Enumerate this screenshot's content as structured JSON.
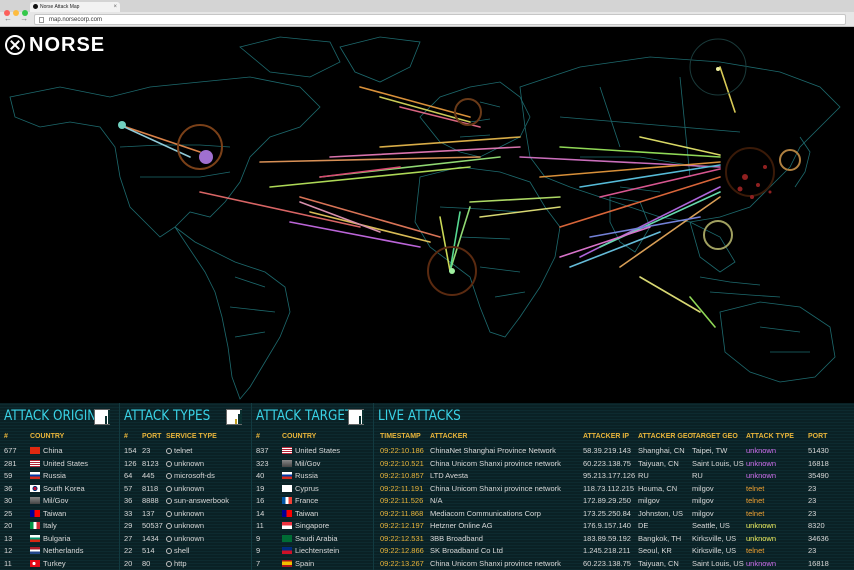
{
  "browser": {
    "tab_title": "Norse Attack Map",
    "tab_close": "×",
    "nav": "← → C",
    "url": "map.norsecorp.com"
  },
  "logo": {
    "text": "NORSE"
  },
  "colors": {
    "accent": "#3ad3e6",
    "header": "#e8b43a",
    "panel_bg": "#0b2227"
  },
  "attack_origins": {
    "title": "ATTACK ORIGINS",
    "headers": [
      "#",
      "COUNTRY"
    ],
    "rows": [
      {
        "count": "677",
        "country": "China",
        "flag": "cn"
      },
      {
        "count": "281",
        "country": "United States",
        "flag": "us"
      },
      {
        "count": "59",
        "country": "Russia",
        "flag": "ru"
      },
      {
        "count": "36",
        "country": "South Korea",
        "flag": "kr"
      },
      {
        "count": "30",
        "country": "Mil/Gov",
        "flag": "mil"
      },
      {
        "count": "25",
        "country": "Taiwan",
        "flag": "tw"
      },
      {
        "count": "20",
        "country": "Italy",
        "flag": "it"
      },
      {
        "count": "13",
        "country": "Bulgaria",
        "flag": "bg"
      },
      {
        "count": "12",
        "country": "Netherlands",
        "flag": "nl"
      },
      {
        "count": "11",
        "country": "Turkey",
        "flag": "tr"
      }
    ]
  },
  "attack_types": {
    "title": "ATTACK TYPES",
    "headers": [
      "#",
      "PORT",
      "SERVICE TYPE"
    ],
    "rows": [
      {
        "count": "154",
        "port": "23",
        "service": "telnet"
      },
      {
        "count": "126",
        "port": "8123",
        "service": "unknown"
      },
      {
        "count": "64",
        "port": "445",
        "service": "microsoft-ds"
      },
      {
        "count": "57",
        "port": "8118",
        "service": "unknown"
      },
      {
        "count": "36",
        "port": "8888",
        "service": "sun-answerbook"
      },
      {
        "count": "33",
        "port": "137",
        "service": "unknown"
      },
      {
        "count": "29",
        "port": "50537",
        "service": "unknown"
      },
      {
        "count": "27",
        "port": "1434",
        "service": "unknown"
      },
      {
        "count": "22",
        "port": "514",
        "service": "shell"
      },
      {
        "count": "20",
        "port": "80",
        "service": "http"
      }
    ]
  },
  "attack_targets": {
    "title": "ATTACK TARGETS",
    "headers": [
      "#",
      "COUNTRY"
    ],
    "rows": [
      {
        "count": "837",
        "country": "United States",
        "flag": "us"
      },
      {
        "count": "323",
        "country": "Mil/Gov",
        "flag": "mil"
      },
      {
        "count": "40",
        "country": "Russia",
        "flag": "ru"
      },
      {
        "count": "19",
        "country": "Cyprus",
        "flag": "cy"
      },
      {
        "count": "16",
        "country": "France",
        "flag": "fr"
      },
      {
        "count": "14",
        "country": "Taiwan",
        "flag": "tw"
      },
      {
        "count": "11",
        "country": "Singapore",
        "flag": "sg"
      },
      {
        "count": "9",
        "country": "Saudi Arabia",
        "flag": "sa"
      },
      {
        "count": "9",
        "country": "Liechtenstein",
        "flag": "li"
      },
      {
        "count": "7",
        "country": "Spain",
        "flag": "es"
      }
    ]
  },
  "live_attacks": {
    "title": "LIVE ATTACKS",
    "headers": [
      "TIMESTAMP",
      "ATTACKER",
      "ATTACKER IP",
      "ATTACKER GEO",
      "TARGET GEO",
      "ATTACK TYPE",
      "PORT"
    ],
    "rows": [
      {
        "time": "09:22:10.186",
        "attacker": "ChinaNet Shanghai Province Network",
        "ip": "58.39.219.143",
        "geo": "Shanghai, CN",
        "target": "Taipei, TW",
        "type": "unknown",
        "port": "51430"
      },
      {
        "time": "09:22:10.521",
        "attacker": "China Unicom Shanxi province network",
        "ip": "60.223.138.75",
        "geo": "Taiyuan, CN",
        "target": "Saint Louis, US",
        "type": "unknown",
        "port": "16818"
      },
      {
        "time": "09:22:10.857",
        "attacker": "LTD Avesta",
        "ip": "95.213.177.126",
        "geo": "RU",
        "target": "RU",
        "type": "unknown",
        "port": "35490"
      },
      {
        "time": "09:22:11.191",
        "attacker": "China Unicom Shanxi province network",
        "ip": "118.73.112.215",
        "geo": "Houma, CN",
        "target": "milgov",
        "type": "telnet",
        "port": "23"
      },
      {
        "time": "09:22:11.526",
        "attacker": "N/A",
        "ip": "172.89.29.250",
        "geo": "milgov",
        "target": "milgov",
        "type": "telnet",
        "port": "23"
      },
      {
        "time": "09:22:11.868",
        "attacker": "Mediacom Communications Corp",
        "ip": "173.25.250.84",
        "geo": "Johnston, US",
        "target": "milgov",
        "type": "telnet",
        "port": "23"
      },
      {
        "time": "09:22:12.197",
        "attacker": "Hetzner Online AG",
        "ip": "176.9.157.140",
        "geo": "DE",
        "target": "Seattle, US",
        "type": "unknown",
        "port": "8320"
      },
      {
        "time": "09:22:12.531",
        "attacker": "3BB Broadband",
        "ip": "183.89.59.192",
        "geo": "Bangkok, TH",
        "target": "Kirksville, US",
        "type": "unknown",
        "port": "34636"
      },
      {
        "time": "09:22:12.866",
        "attacker": "SK Broadband Co Ltd",
        "ip": "1.245.218.211",
        "geo": "Seoul, KR",
        "target": "Kirksville, US",
        "type": "telnet",
        "port": "23"
      },
      {
        "time": "09:22:13.267",
        "attacker": "China Unicom Shanxi province network",
        "ip": "60.223.138.75",
        "geo": "Taiyuan, CN",
        "target": "Saint Louis, US",
        "type": "unknown",
        "port": "16818"
      }
    ]
  }
}
